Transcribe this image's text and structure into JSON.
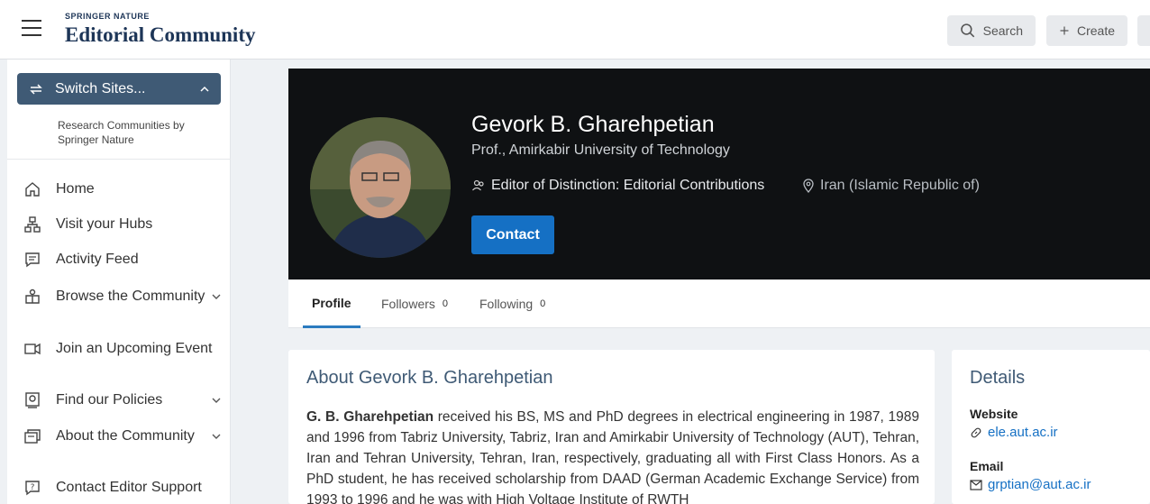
{
  "header": {
    "brand_top": "SPRINGER NATURE",
    "brand_main": "Editorial Community",
    "search_label": "Search",
    "create_label": "Create"
  },
  "sidebar": {
    "switch_label": "Switch Sites...",
    "switch_sub": "Research Communities by Springer Nature",
    "items": [
      {
        "label": "Home",
        "icon": "home-icon"
      },
      {
        "label": "Visit your Hubs",
        "icon": "hubs-icon"
      },
      {
        "label": "Activity Feed",
        "icon": "feed-icon"
      },
      {
        "label": "Browse the Community",
        "icon": "browse-icon"
      },
      {
        "label": "Join an Upcoming Event",
        "icon": "event-icon"
      },
      {
        "label": "Find our Policies",
        "icon": "policies-icon"
      },
      {
        "label": "About the Community",
        "icon": "about-icon"
      },
      {
        "label": "Contact Editor Support",
        "icon": "support-icon"
      }
    ]
  },
  "profile": {
    "name": "Gevork B. Gharehpetian",
    "role": "Prof., Amirkabir University of Technology",
    "badge": "Editor of Distinction: Editorial Contributions",
    "location": "Iran (Islamic Republic of)",
    "contact_label": "Contact"
  },
  "tabs": [
    {
      "label": "Profile"
    },
    {
      "label": "Followers",
      "count": "0"
    },
    {
      "label": "Following",
      "count": "0"
    }
  ],
  "about": {
    "title": "About Gevork B. Gharehpetian",
    "name_bold": "G. B. Gharehpetian",
    "text": " received his BS, MS and PhD degrees in electrical engineering in 1987, 1989 and 1996 from Tabriz University, Tabriz, Iran and Amirkabir University of Technology (AUT), Tehran, Iran and Tehran University, Tehran, Iran, respectively, graduating all with First Class Honors. As a PhD student, he has received scholarship from DAAD (German Academic Exchange Service) from 1993 to 1996 and he was with High Voltage Institute of RWTH"
  },
  "details": {
    "title": "Details",
    "website_label": "Website",
    "website_value": "ele.aut.ac.ir",
    "email_label": "Email",
    "email_value": "grptian@aut.ac.ir"
  },
  "colors": {
    "accent": "#1570c4",
    "sidebar_switch": "#3f5a75",
    "hero_bg": "#0f1113"
  }
}
